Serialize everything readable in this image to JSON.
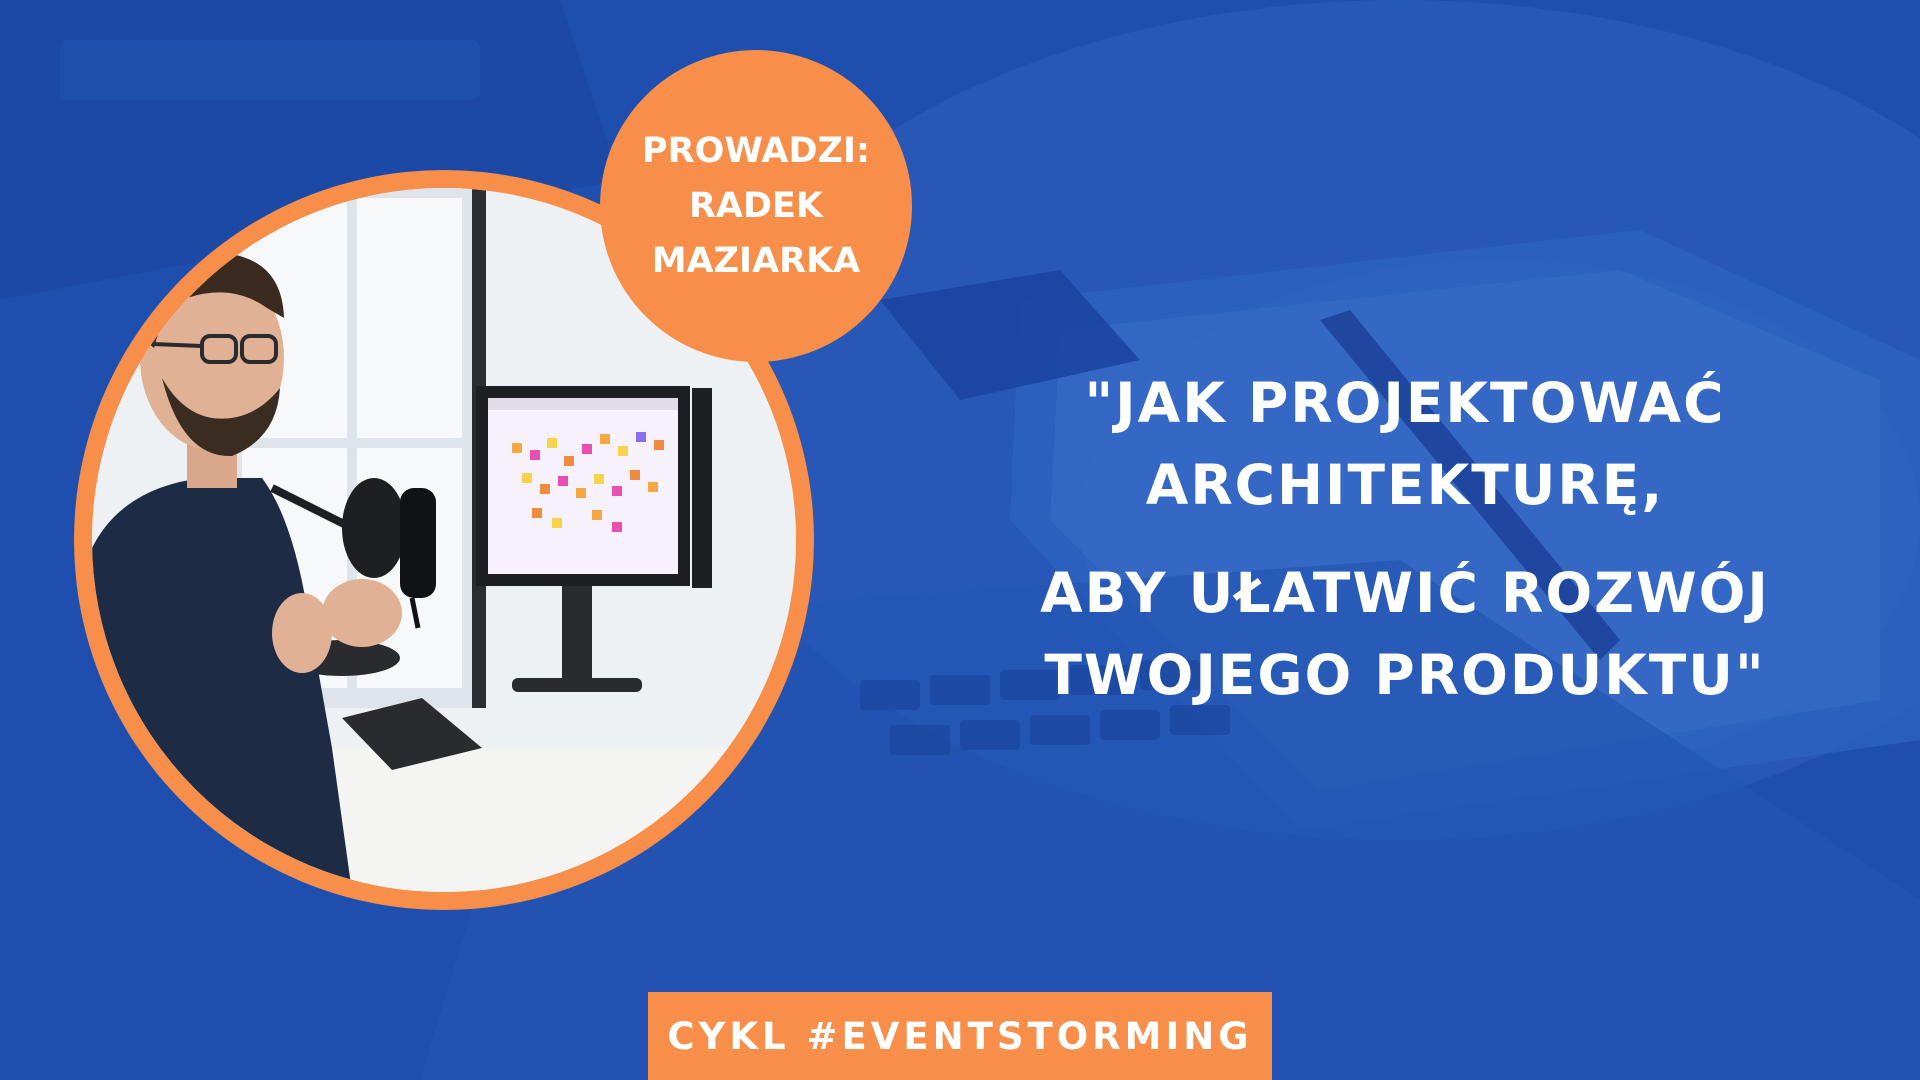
{
  "host": {
    "line1": "PROWADZI:",
    "line2": "RADEK",
    "line3": "MAZIARKA"
  },
  "headline": {
    "line1": "\"JAK PROJEKTOWAĆ",
    "line2": "ARCHITEKTURĘ,",
    "line3": "ABY UŁATWIĆ ROZWÓJ",
    "line4": "TWOJEGO PRODUKTU\""
  },
  "series": {
    "label": "CYKL #EVENTSTORMING"
  },
  "colors": {
    "background_blue": "#1f4fae",
    "accent_orange": "#f78e4a",
    "text_white": "#ffffff"
  }
}
